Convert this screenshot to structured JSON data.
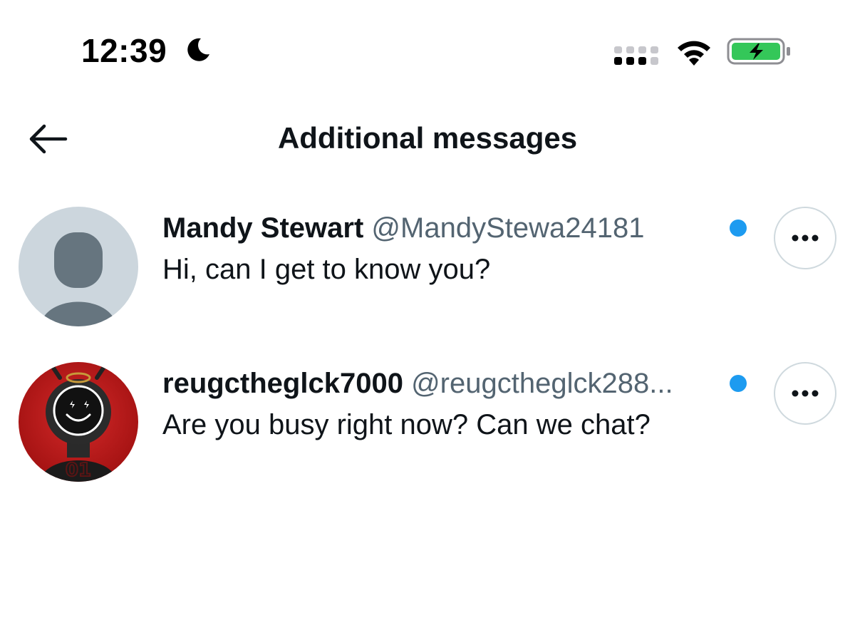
{
  "status_bar": {
    "time": "12:39",
    "icons": [
      "moon-icon",
      "cellular-signal-icon",
      "wifi-icon",
      "battery-charging-icon"
    ],
    "battery_color": "#34c759"
  },
  "header": {
    "title": "Additional messages",
    "back_icon": "arrow-left-icon"
  },
  "conversations": [
    {
      "name": "Mandy Stewart",
      "handle": "@MandyStewa24181",
      "message": "Hi, can I get to know you?",
      "unread": true,
      "avatar": "default-profile-placeholder"
    },
    {
      "name": "reugctheglck7000",
      "handle": "@reugctheglck288...",
      "message": "Are you busy right now? Can we chat?",
      "unread": true,
      "avatar": "helmet-character-on-red"
    }
  ],
  "colors": {
    "unread_dot": "#1d9bf0",
    "handle_gray": "#536471",
    "text_primary": "#0f1419"
  }
}
